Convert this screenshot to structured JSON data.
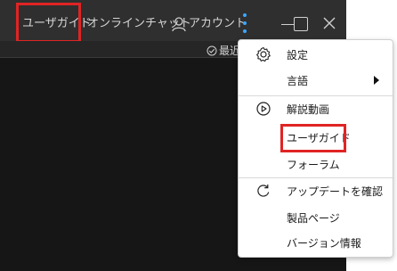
{
  "titlebar": {
    "user_guide": "ユーザガイド",
    "online_chat": "オンラインチャット",
    "account": "アカウント",
    "icons": [
      "user-icon",
      "more-vertical-icon",
      "minimize-icon",
      "maximize-icon",
      "close-icon"
    ]
  },
  "subbar": {
    "recent": "最近"
  },
  "menu": {
    "settings": "設定",
    "language": "言語",
    "tutorial_video": "解説動画",
    "user_guide": "ユーザガイド",
    "forum": "フォーラム",
    "check_update": "アップデートを確認",
    "products": "製品ページ",
    "version_info": "バージョン情報"
  },
  "colors": {
    "highlight": "#e02424",
    "accent": "#3ba7ff",
    "dark_bg": "#2f2f2f"
  }
}
